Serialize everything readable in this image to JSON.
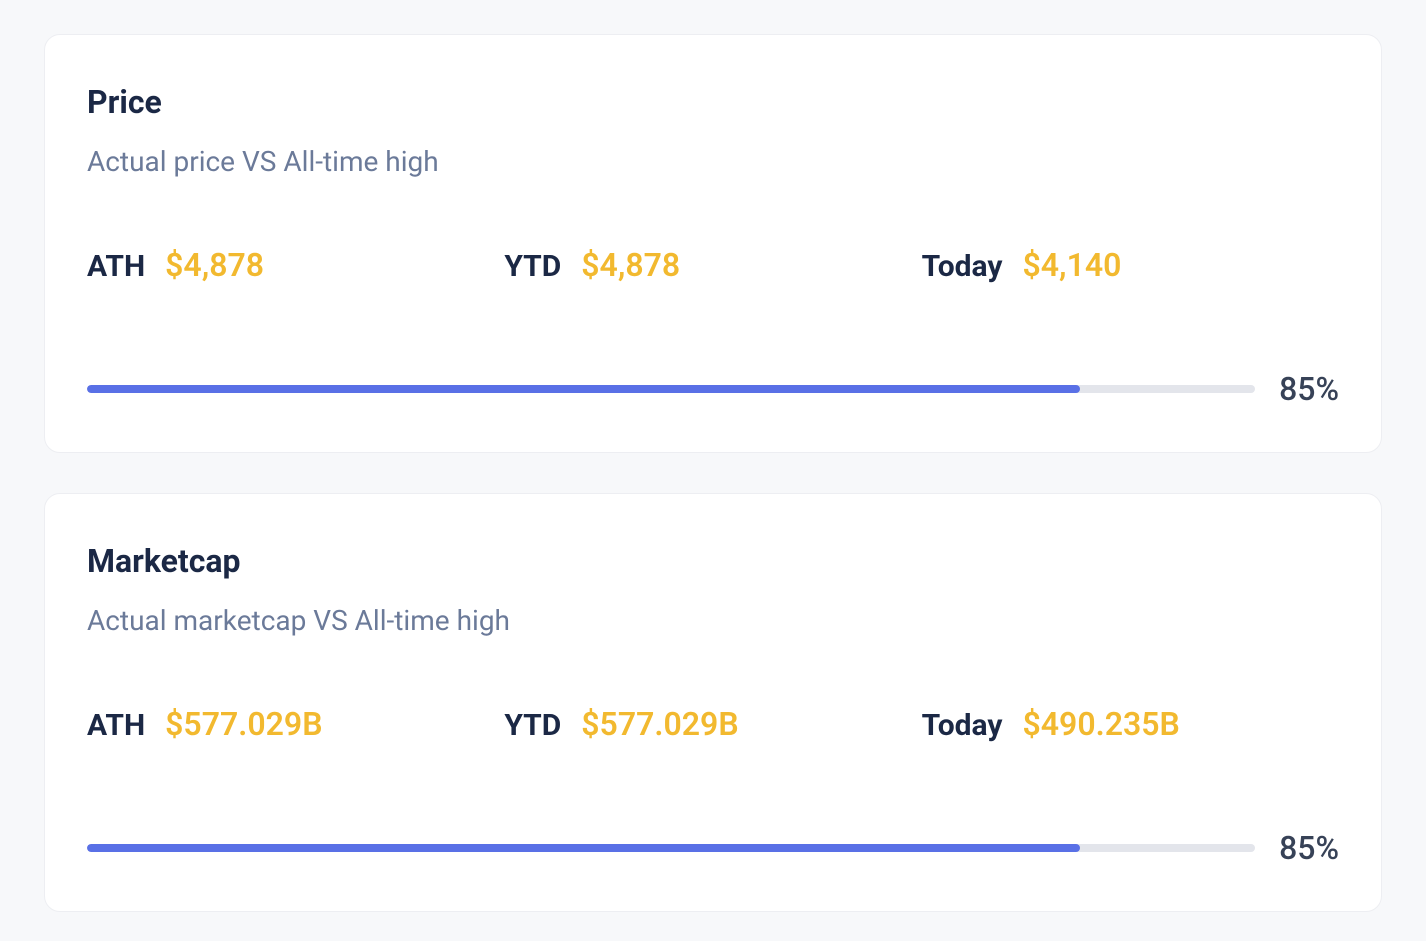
{
  "cards": [
    {
      "title": "Price",
      "subtitle": "Actual price VS All-time high",
      "stats": [
        {
          "label": "ATH",
          "value": "$4,878"
        },
        {
          "label": "YTD",
          "value": "$4,878"
        },
        {
          "label": "Today",
          "value": "$4,140"
        }
      ],
      "progress": {
        "percent": 85,
        "label": "85%"
      }
    },
    {
      "title": "Marketcap",
      "subtitle": "Actual marketcap VS All-time high",
      "stats": [
        {
          "label": "ATH",
          "value": "$577.029B"
        },
        {
          "label": "YTD",
          "value": "$577.029B"
        },
        {
          "label": "Today",
          "value": "$490.235B"
        }
      ],
      "progress": {
        "percent": 85,
        "label": "85%"
      }
    }
  ]
}
